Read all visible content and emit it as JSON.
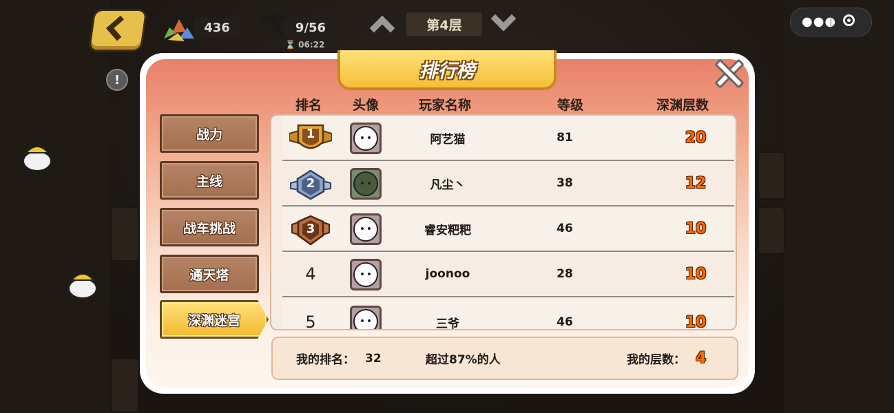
{
  "hud": {
    "ore_count": "436",
    "pickaxe_count": "9/56",
    "timer": "06:22",
    "floor_label": "第4层",
    "info_label": "!"
  },
  "wechat_capsule": {
    "menu_icon": "more-dots-icon",
    "close_icon": "target-circle-icon"
  },
  "leaderboard": {
    "title": "排行榜",
    "columns": [
      "排名",
      "头像",
      "玩家名称",
      "等级",
      "深渊层数"
    ],
    "categories": [
      {
        "label": "战力",
        "active": false
      },
      {
        "label": "主线",
        "active": false
      },
      {
        "label": "战车挑战",
        "active": false
      },
      {
        "label": "通天塔",
        "active": false
      },
      {
        "label": "深渊迷宫",
        "active": true
      }
    ],
    "rows": [
      {
        "rank": "1",
        "name": "阿艺猫",
        "level": "81",
        "depth": "20",
        "medal": "gold"
      },
      {
        "rank": "2",
        "name": "凡尘丶",
        "level": "38",
        "depth": "12",
        "medal": "silver"
      },
      {
        "rank": "3",
        "name": "睿安粑粑",
        "level": "46",
        "depth": "10",
        "medal": "bronze"
      },
      {
        "rank": "4",
        "name": "joonoo",
        "level": "28",
        "depth": "10",
        "medal": ""
      },
      {
        "rank": "5",
        "name": "三爷",
        "level": "46",
        "depth": "10",
        "medal": ""
      }
    ],
    "footer": {
      "my_rank_label": "我的排名：",
      "my_rank_value": "32",
      "percent_text": "超过87%的人",
      "my_floor_label": "我的层数：",
      "my_floor_value": "4"
    }
  },
  "colors": {
    "gold": "#e0a43a",
    "silver": "#8ca5c8",
    "bronze": "#b86e3c",
    "accent_orange": "#ff6a00"
  }
}
